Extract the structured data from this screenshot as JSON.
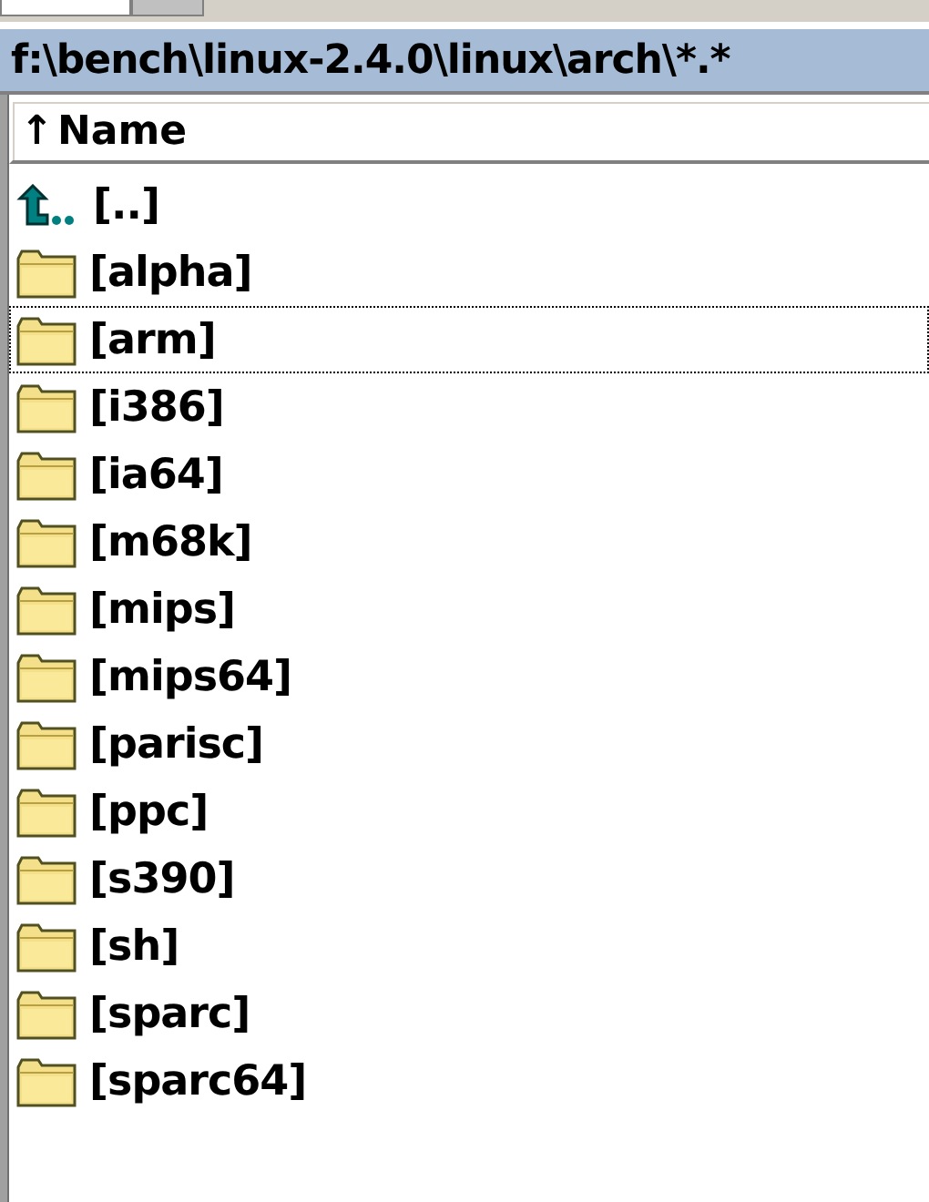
{
  "path_bar": {
    "text": "f:\\bench\\linux-2.4.0\\linux\\arch\\*.*"
  },
  "header": {
    "sort_arrow": "↑",
    "label": "Name"
  },
  "files": [
    {
      "kind": "up",
      "name": "[..]",
      "focused": false
    },
    {
      "kind": "folder",
      "name": "[alpha]",
      "focused": false
    },
    {
      "kind": "folder",
      "name": "[arm]",
      "focused": true
    },
    {
      "kind": "folder",
      "name": "[i386]",
      "focused": false
    },
    {
      "kind": "folder",
      "name": "[ia64]",
      "focused": false
    },
    {
      "kind": "folder",
      "name": "[m68k]",
      "focused": false
    },
    {
      "kind": "folder",
      "name": "[mips]",
      "focused": false
    },
    {
      "kind": "folder",
      "name": "[mips64]",
      "focused": false
    },
    {
      "kind": "folder",
      "name": "[parisc]",
      "focused": false
    },
    {
      "kind": "folder",
      "name": "[ppc]",
      "focused": false
    },
    {
      "kind": "folder",
      "name": "[s390]",
      "focused": false
    },
    {
      "kind": "folder",
      "name": "[sh]",
      "focused": false
    },
    {
      "kind": "folder",
      "name": "[sparc]",
      "focused": false
    },
    {
      "kind": "folder",
      "name": "[sparc64]",
      "focused": false
    }
  ]
}
